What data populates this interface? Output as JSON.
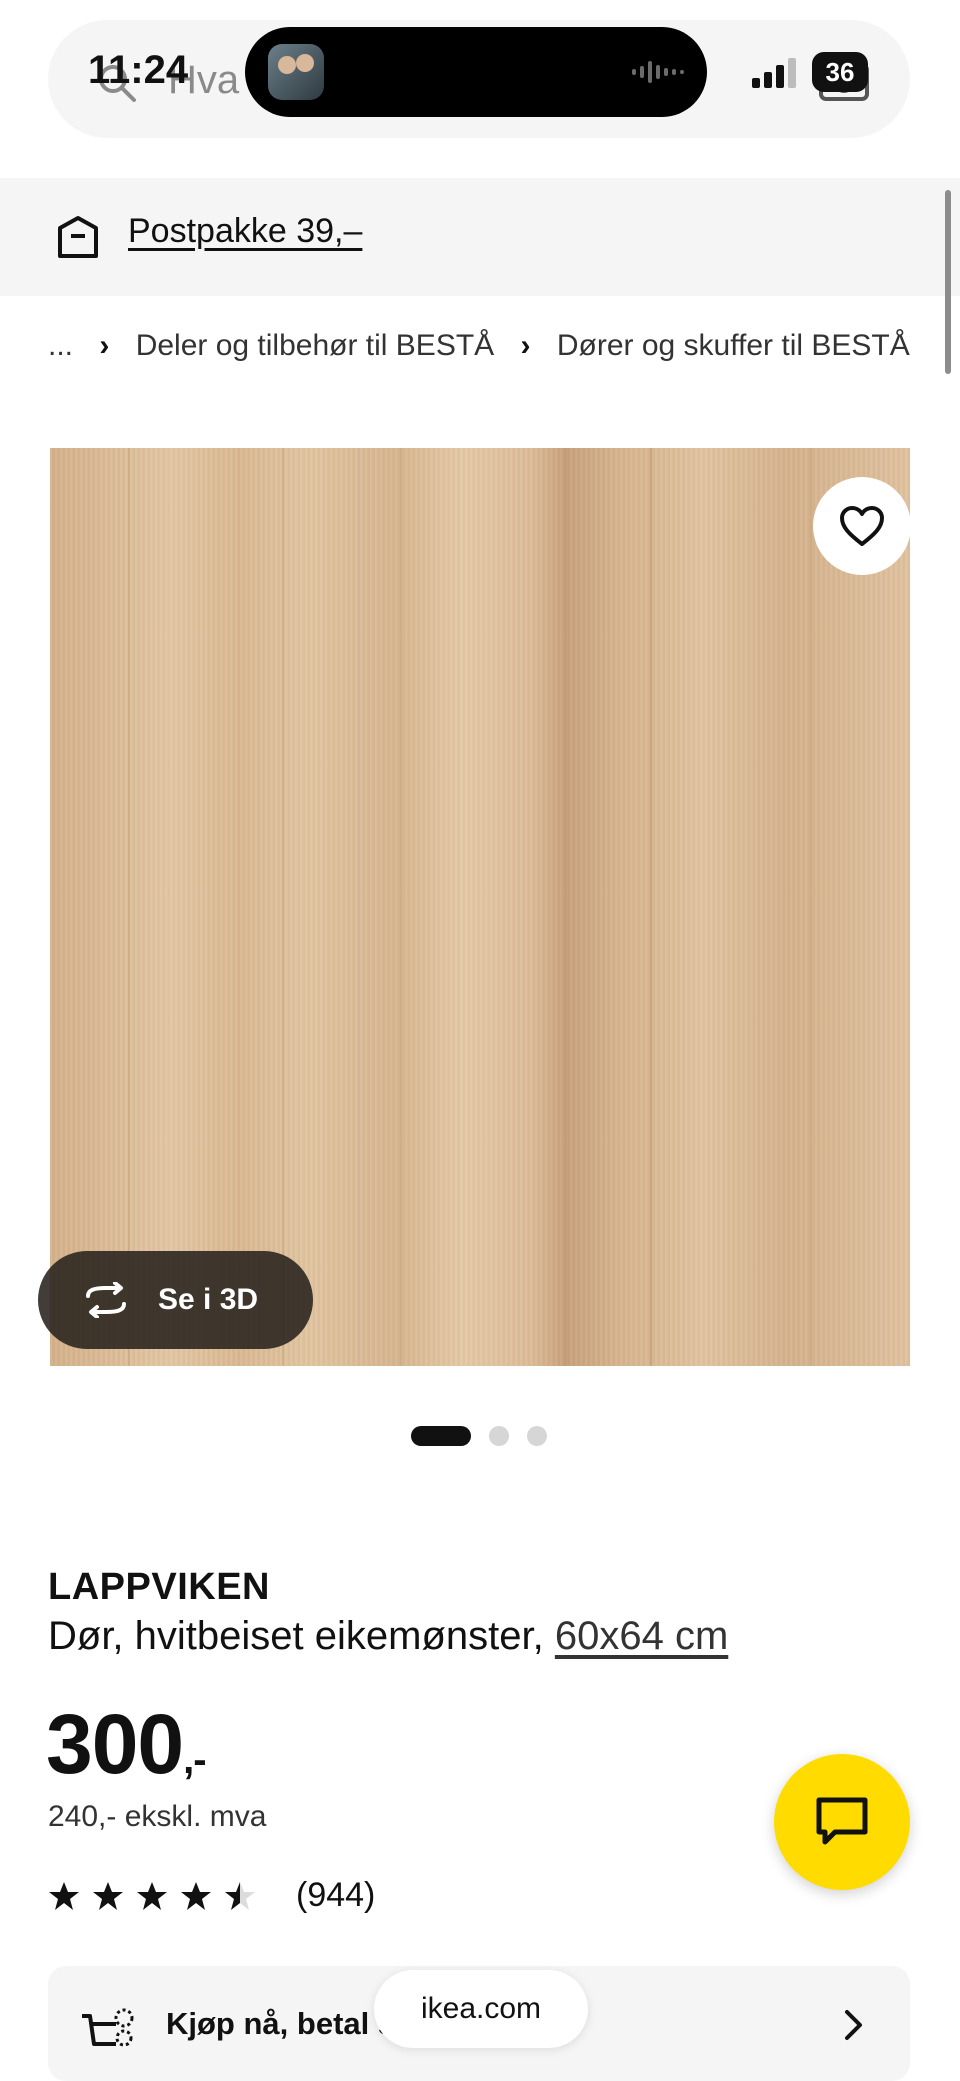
{
  "status_bar": {
    "time": "11:24",
    "battery": "36"
  },
  "search": {
    "placeholder": "Hva l"
  },
  "banner": {
    "delivery_link": "Postpakke 39,–"
  },
  "breadcrumb": {
    "items": [
      "...",
      "Deler og tilbehør til BESTÅ",
      "Dører og skuffer til BESTÅ"
    ]
  },
  "gallery": {
    "view_3d_label": "Se i 3D",
    "slide_count": 3,
    "active_slide": 1
  },
  "product": {
    "name": "LAPPVIKEN",
    "description": "Dør, hvitbeiset eikemønster,",
    "size": "60x64 cm",
    "price": "300",
    "price_suffix": ",-",
    "price_ex_vat": "240,- ekskl. mva",
    "rating_value": 4.5,
    "rating_max": 5,
    "review_count": "(944)"
  },
  "pay_later": {
    "label": "Kjøp nå, betal senere"
  },
  "browser": {
    "url": "ikea.com"
  },
  "colors": {
    "brand_yellow": "#ffdb00",
    "banner_gray": "#f5f5f5",
    "text": "#111111"
  },
  "icons": [
    "search-icon",
    "camera-icon",
    "box-icon",
    "heart-icon",
    "rotate-3d-icon",
    "star-icon",
    "chat-icon",
    "cart-icon",
    "chevron-right-icon"
  ]
}
